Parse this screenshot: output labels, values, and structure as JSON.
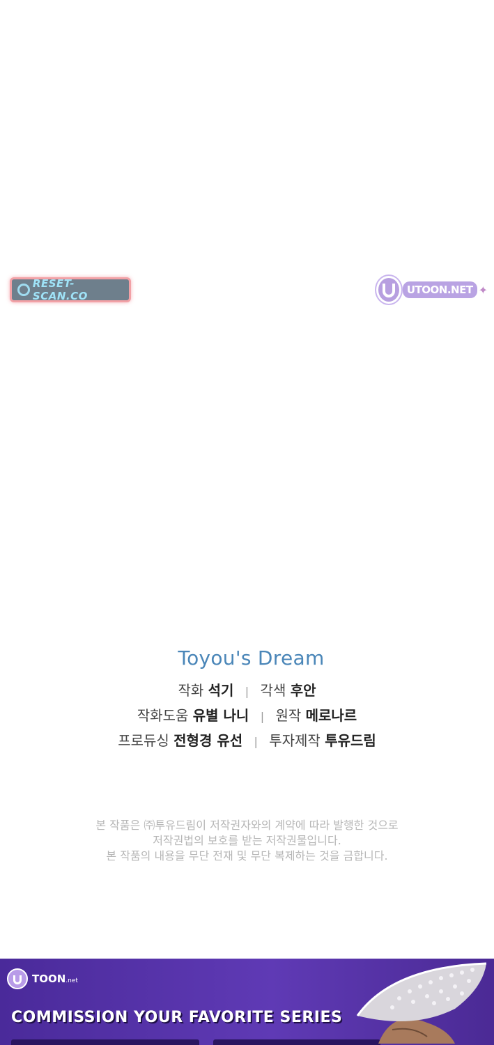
{
  "watermarks": {
    "reset_scan": "RESET-SCAN.CO",
    "utoon": "UTOON.NET"
  },
  "credits": {
    "brand": "Toyou's Dream",
    "lines": [
      [
        {
          "role": "작화",
          "name": "석기"
        },
        {
          "role": "각색",
          "name": "후안"
        }
      ],
      [
        {
          "role": "작화도움",
          "name": "유별 나니"
        },
        {
          "role": "원작",
          "name": "메로나르"
        }
      ],
      [
        {
          "role": "프로듀싱",
          "name": "전형경 유선"
        },
        {
          "role": "투자제작",
          "name": "투유드림"
        }
      ]
    ]
  },
  "notice": {
    "line1": "본 작품은 ㈜투유드림이 저작권자와의 계약에 따라 발행한 것으로",
    "line2": "저작권법의 보호를 받는 저작권물입니다.",
    "line3": "본 작품의 내용을 무단 전재 및 무단 복제하는 것을 금합니다."
  },
  "banner": {
    "logo": "TOON",
    "logo_suffix": ".net",
    "headline": "COMMISSION YOUR FAVORITE SERIES",
    "colors": {
      "bg": "#5b36ad",
      "accent": "#b89be8"
    }
  }
}
